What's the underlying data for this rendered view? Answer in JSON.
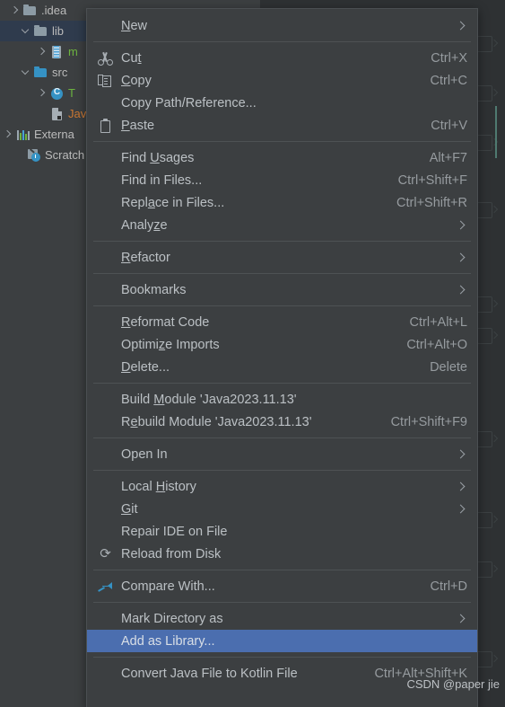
{
  "window": {
    "app": "IntelliJ IDEA",
    "background_color": "#3c3f41",
    "editor_background_color": "#2e3133",
    "accent_selection_color": "#4b6eaf",
    "tree_selection_color": "#2f3b4d"
  },
  "project_tree": {
    "name": "Project tool window",
    "rows": [
      {
        "label": ".idea",
        "icon": "folder-icon",
        "arrow": "right",
        "indent": 10,
        "selected": false,
        "color": "#bbbbbb"
      },
      {
        "label": "lib",
        "icon": "folder-icon",
        "arrow": "down",
        "indent": 22,
        "selected": true,
        "color": "#bbbbbb"
      },
      {
        "label": "m",
        "icon": "jar-icon",
        "arrow": "right",
        "indent": 40,
        "selected": false,
        "color": "#6cb33f"
      },
      {
        "label": "src",
        "icon": "folder-src-icon",
        "arrow": "down",
        "indent": 22,
        "selected": false,
        "color": "#bbbbbb"
      },
      {
        "label": "T",
        "icon": "java-class-icon",
        "arrow": "right",
        "indent": 40,
        "selected": false,
        "color": "#6cb33f"
      },
      {
        "label": "Java",
        "icon": "java-file-icon",
        "arrow": "none",
        "indent": 40,
        "selected": false,
        "color": "#cc7832"
      },
      {
        "label": "Externa",
        "icon": "external-libraries-icon",
        "arrow": "right",
        "indent": 2,
        "selected": false,
        "color": "#bbbbbb"
      },
      {
        "label": "Scratch",
        "icon": "scratches-icon",
        "arrow": "none",
        "indent": 14,
        "selected": false,
        "color": "#bbbbbb"
      }
    ]
  },
  "context_menu": {
    "name": "file-context-menu",
    "items": [
      {
        "type": "item",
        "label": "New",
        "mnemonic": "N",
        "icon": null,
        "shortcut": null,
        "submenu": true,
        "selected": false
      },
      {
        "type": "separator"
      },
      {
        "type": "item",
        "label": "Cut",
        "mnemonic": "t",
        "icon": "scissors-icon",
        "shortcut": "Ctrl+X",
        "submenu": false,
        "selected": false
      },
      {
        "type": "item",
        "label": "Copy",
        "mnemonic": "C",
        "icon": "copy-icon",
        "shortcut": "Ctrl+C",
        "submenu": false,
        "selected": false
      },
      {
        "type": "item",
        "label": "Copy Path/Reference...",
        "mnemonic": null,
        "icon": null,
        "shortcut": null,
        "submenu": false,
        "selected": false
      },
      {
        "type": "item",
        "label": "Paste",
        "mnemonic": "P",
        "icon": "paste-icon",
        "shortcut": "Ctrl+V",
        "submenu": false,
        "selected": false
      },
      {
        "type": "separator"
      },
      {
        "type": "item",
        "label": "Find Usages",
        "mnemonic": "U",
        "icon": null,
        "shortcut": "Alt+F7",
        "submenu": false,
        "selected": false
      },
      {
        "type": "item",
        "label": "Find in Files...",
        "mnemonic": null,
        "icon": null,
        "shortcut": "Ctrl+Shift+F",
        "submenu": false,
        "selected": false
      },
      {
        "type": "item",
        "label": "Replace in Files...",
        "mnemonic": "a",
        "icon": null,
        "shortcut": "Ctrl+Shift+R",
        "submenu": false,
        "selected": false
      },
      {
        "type": "item",
        "label": "Analyze",
        "mnemonic": "z",
        "icon": null,
        "shortcut": null,
        "submenu": true,
        "selected": false
      },
      {
        "type": "separator"
      },
      {
        "type": "item",
        "label": "Refactor",
        "mnemonic": "R",
        "icon": null,
        "shortcut": null,
        "submenu": true,
        "selected": false
      },
      {
        "type": "separator"
      },
      {
        "type": "item",
        "label": "Bookmarks",
        "mnemonic": null,
        "icon": null,
        "shortcut": null,
        "submenu": true,
        "selected": false
      },
      {
        "type": "separator"
      },
      {
        "type": "item",
        "label": "Reformat Code",
        "mnemonic": "R",
        "icon": null,
        "shortcut": "Ctrl+Alt+L",
        "submenu": false,
        "selected": false
      },
      {
        "type": "item",
        "label": "Optimize Imports",
        "mnemonic": "z",
        "icon": null,
        "shortcut": "Ctrl+Alt+O",
        "submenu": false,
        "selected": false
      },
      {
        "type": "item",
        "label": "Delete...",
        "mnemonic": "D",
        "icon": null,
        "shortcut": "Delete",
        "submenu": false,
        "selected": false
      },
      {
        "type": "separator"
      },
      {
        "type": "item",
        "label": "Build Module 'Java2023.11.13'",
        "mnemonic": "M",
        "icon": null,
        "shortcut": null,
        "submenu": false,
        "selected": false
      },
      {
        "type": "item",
        "label": "Rebuild Module 'Java2023.11.13'",
        "mnemonic": "e",
        "icon": null,
        "shortcut": "Ctrl+Shift+F9",
        "submenu": false,
        "selected": false
      },
      {
        "type": "separator"
      },
      {
        "type": "item",
        "label": "Open In",
        "mnemonic": null,
        "icon": null,
        "shortcut": null,
        "submenu": true,
        "selected": false
      },
      {
        "type": "separator"
      },
      {
        "type": "item",
        "label": "Local History",
        "mnemonic": "H",
        "icon": null,
        "shortcut": null,
        "submenu": true,
        "selected": false
      },
      {
        "type": "item",
        "label": "Git",
        "mnemonic": "G",
        "icon": null,
        "shortcut": null,
        "submenu": true,
        "selected": false
      },
      {
        "type": "item",
        "label": "Repair IDE on File",
        "mnemonic": null,
        "icon": null,
        "shortcut": null,
        "submenu": false,
        "selected": false
      },
      {
        "type": "item",
        "label": "Reload from Disk",
        "mnemonic": null,
        "icon": "reload-icon",
        "shortcut": null,
        "submenu": false,
        "selected": false
      },
      {
        "type": "separator"
      },
      {
        "type": "item",
        "label": "Compare With...",
        "mnemonic": null,
        "icon": "compare-icon",
        "shortcut": "Ctrl+D",
        "submenu": false,
        "selected": false
      },
      {
        "type": "separator"
      },
      {
        "type": "item",
        "label": "Mark Directory as",
        "mnemonic": null,
        "icon": null,
        "shortcut": null,
        "submenu": true,
        "selected": false
      },
      {
        "type": "item",
        "label": "Add as Library...",
        "mnemonic": null,
        "icon": null,
        "shortcut": null,
        "submenu": false,
        "selected": true
      },
      {
        "type": "separator"
      },
      {
        "type": "item",
        "label": "Convert Java File to Kotlin File",
        "mnemonic": null,
        "icon": null,
        "shortcut": "Ctrl+Alt+Shift+K",
        "submenu": false,
        "selected": false
      }
    ]
  },
  "watermark": {
    "text": "CSDN @paper jie"
  }
}
